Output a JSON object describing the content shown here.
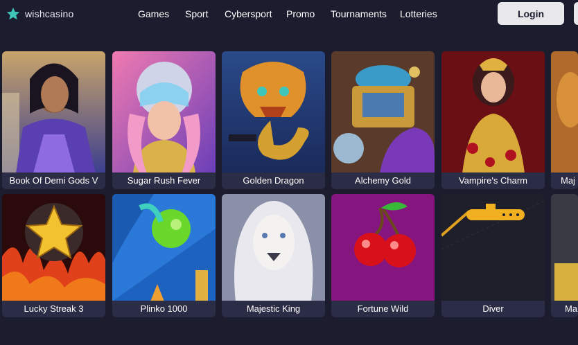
{
  "brand": {
    "name": "wishcasino",
    "icon": "star-icon",
    "accent": "#3fc6b8"
  },
  "nav": {
    "items": [
      {
        "label": "Games"
      },
      {
        "label": "Sport"
      },
      {
        "label": "Cybersport"
      },
      {
        "label": "Promo"
      },
      {
        "label": "Tournaments"
      },
      {
        "label": "Lotteries"
      }
    ]
  },
  "header": {
    "login_label": "Login"
  },
  "games": {
    "row1": [
      {
        "title": "Book Of Demi Gods V"
      },
      {
        "title": "Sugar Rush Fever"
      },
      {
        "title": "Golden Dragon"
      },
      {
        "title": "Alchemy Gold"
      },
      {
        "title": "Vampire's Charm"
      },
      {
        "title": "Maj"
      }
    ],
    "row2": [
      {
        "title": "Lucky Streak 3"
      },
      {
        "title": "Plinko 1000"
      },
      {
        "title": "Majestic King"
      },
      {
        "title": "Fortune Wild"
      },
      {
        "title": "Diver"
      },
      {
        "title": "Ma"
      }
    ]
  }
}
